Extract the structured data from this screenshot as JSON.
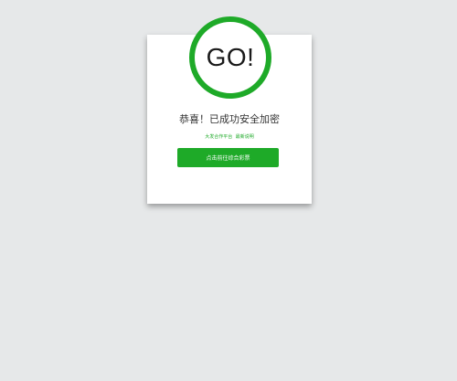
{
  "logo": {
    "text": "GO!",
    "ring_color": "#1eaa28"
  },
  "message": {
    "title": "恭喜！已成功安全加密"
  },
  "links": {
    "left": "大发合作平台",
    "right": "最新说明"
  },
  "cta": {
    "label": "点击前往综合彩票",
    "color": "#1eaa28"
  }
}
